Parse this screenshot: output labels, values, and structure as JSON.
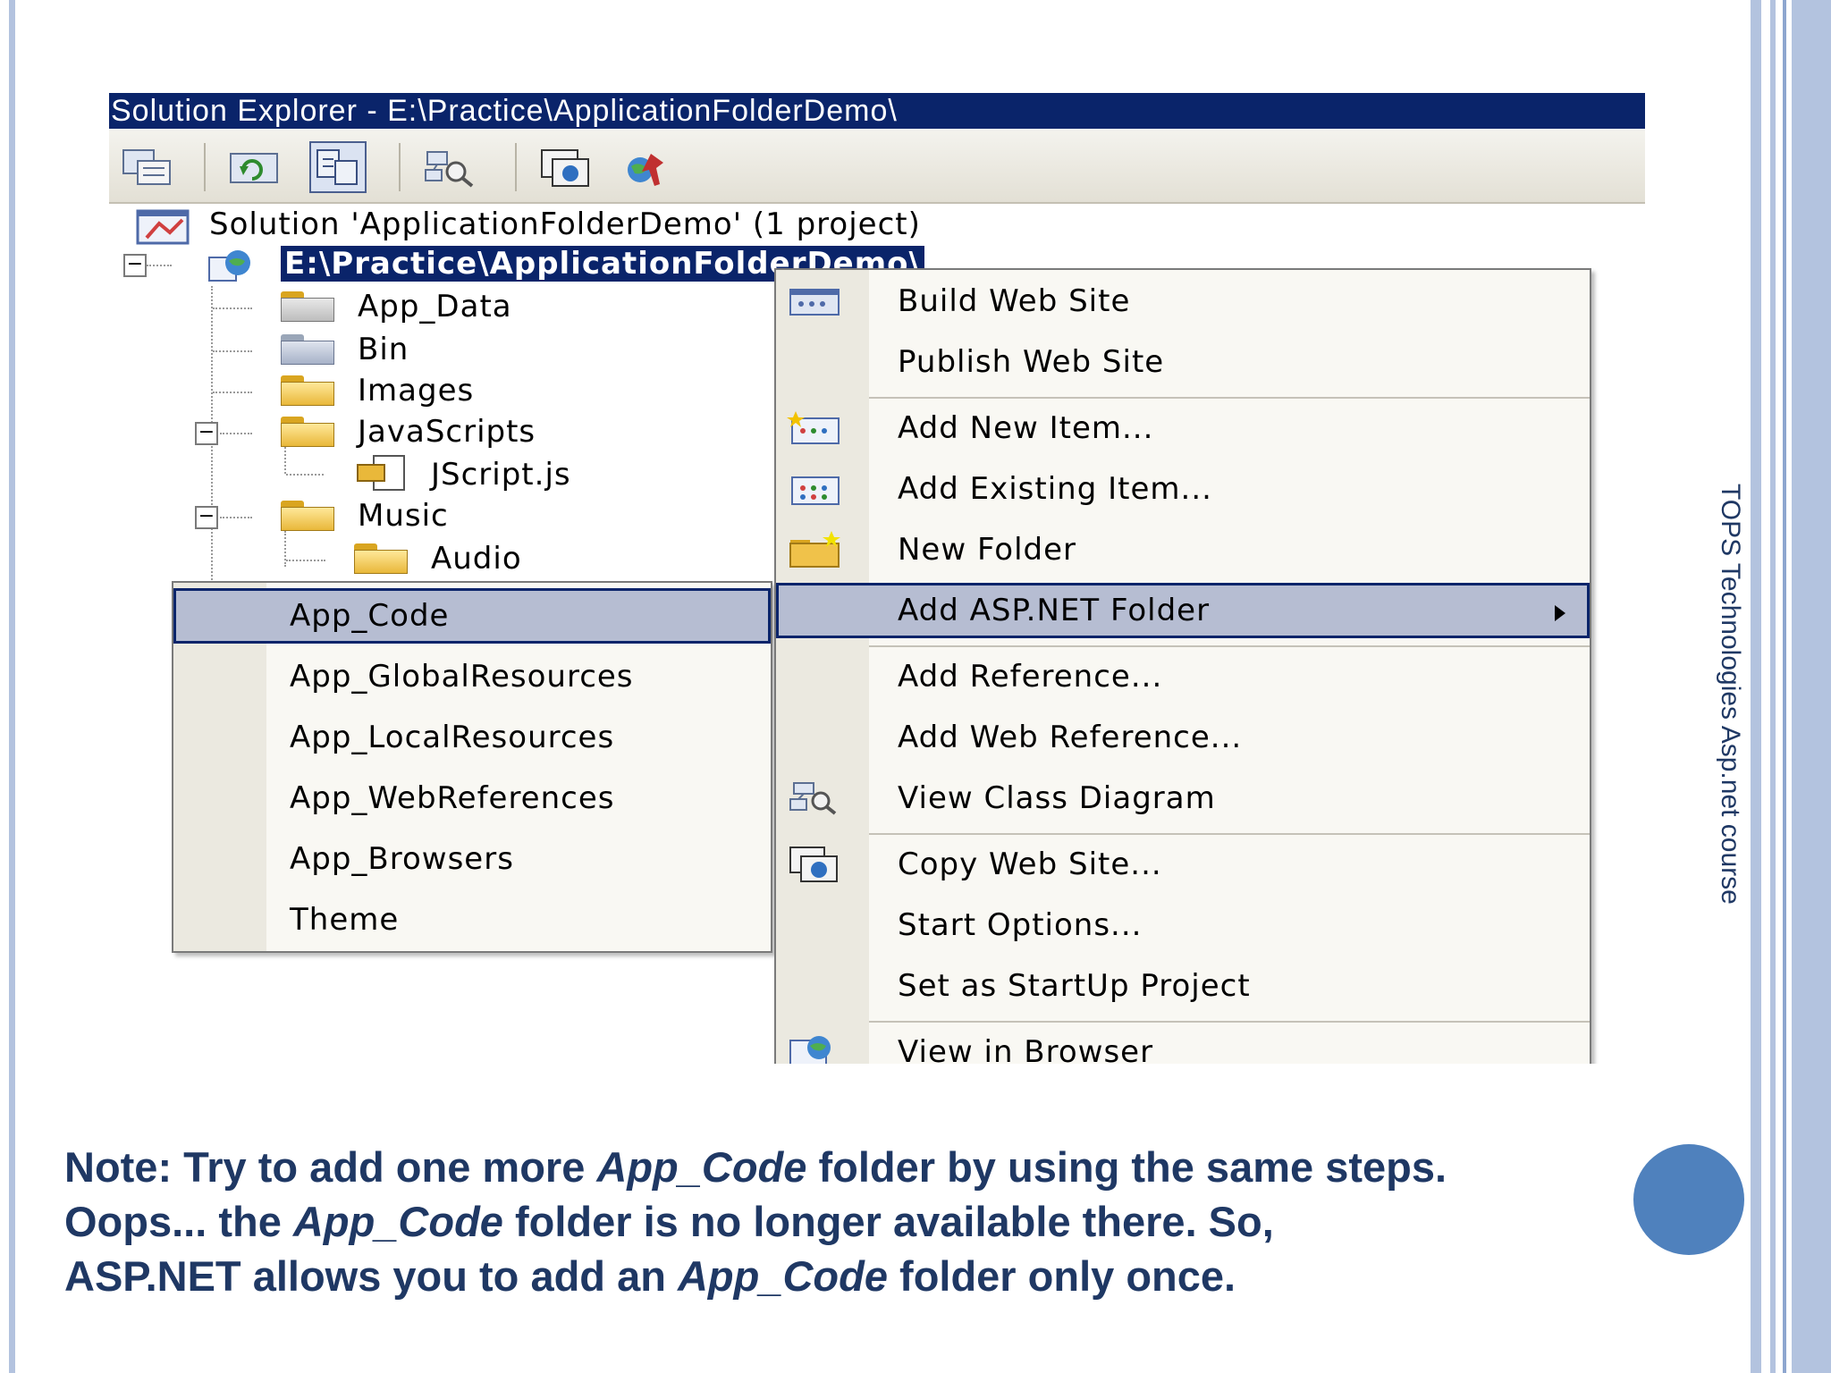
{
  "slide": {
    "side_text": "TOPS Technologies Asp.net course",
    "note": {
      "line1_a": "Note: Try to add one more ",
      "line1_em": "App_Code",
      "line1_b": " folder by using the same steps.",
      "line2_a": "Oops... the ",
      "line2_em": "App_Code",
      "line2_b": " folder is no longer available there. So,",
      "line3_a": "ASP.NET allows you to add an ",
      "line3_em": "App_Code",
      "line3_b": " folder only once."
    },
    "colors": {
      "accent": "#4f81bd",
      "text": "#1f3864",
      "stripe": "#b3c3df"
    }
  },
  "solution_explorer": {
    "title": "Solution Explorer - E:\\Practice\\ApplicationFolderDemo\\",
    "toolbar_icons": [
      "properties-icon",
      "refresh-icon",
      "nest-related-files-icon",
      "view-class-diagram-icon",
      "copy-web-site-icon",
      "asp-net-configuration-icon"
    ],
    "tree": {
      "solution": "Solution 'ApplicationFolderDemo' (1 project)",
      "project": "E:\\Practice\\ApplicationFolderDemo\\",
      "items": {
        "app_data": "App_Data",
        "bin": "Bin",
        "images": "Images",
        "javascripts": "JavaScripts",
        "jscript": "JScript.js",
        "music": "Music",
        "audio": "Audio"
      }
    }
  },
  "context_menu": {
    "items": {
      "build": "Build Web Site",
      "publish": "Publish Web Site",
      "add_new": "Add New Item...",
      "add_existing": "Add Existing Item...",
      "new_folder": "New Folder",
      "add_aspnet_folder": "Add ASP.NET Folder",
      "add_reference": "Add Reference...",
      "add_web_reference": "Add Web Reference...",
      "view_class_diagram": "View Class Diagram",
      "copy_web_site": "Copy Web Site...",
      "start_options": "Start Options...",
      "set_startup": "Set as StartUp Project",
      "view_in_browser": "View in Browser"
    }
  },
  "submenu": {
    "items": {
      "app_code": "App_Code",
      "app_global": "App_GlobalResources",
      "app_local": "App_LocalResources",
      "app_webrefs": "App_WebReferences",
      "app_browsers": "App_Browsers",
      "theme": "Theme"
    }
  }
}
